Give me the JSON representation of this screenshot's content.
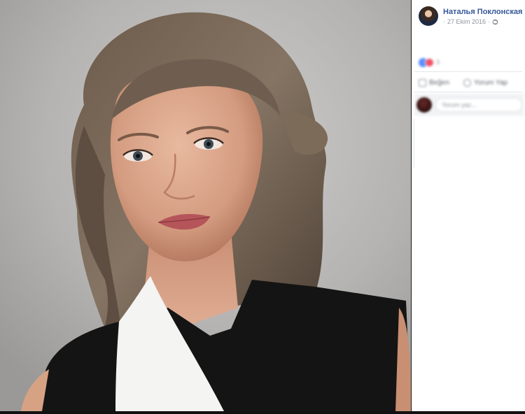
{
  "post": {
    "author": "Наталья Поклонская",
    "date": "27 Ekim 2016",
    "separator": "·",
    "privacy_icon": "globe-icon"
  },
  "reactions": {
    "icons": [
      "like-reaction-icon",
      "love-reaction-icon"
    ],
    "count": "3"
  },
  "actions": {
    "like_label": "Beğen",
    "comment_label": "Yorum Yap"
  },
  "comment": {
    "placeholder": "Yorum yaz..."
  },
  "photo": {
    "description_icon": "portrait-photo"
  },
  "colors": {
    "link": "#365899",
    "meta": "#90949c",
    "like": "#5890ff",
    "love": "#f25268",
    "sidebar_bg": "#ffffff",
    "viewer_bg": "#1c1c1c"
  }
}
